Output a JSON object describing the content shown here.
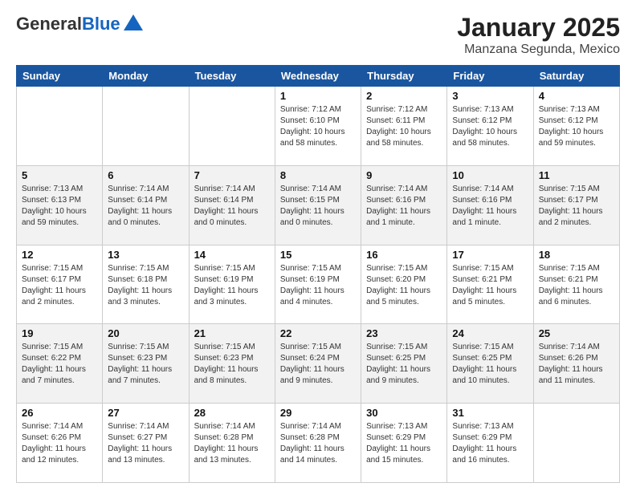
{
  "header": {
    "logo_general": "General",
    "logo_blue": "Blue",
    "title": "January 2025",
    "subtitle": "Manzana Segunda, Mexico"
  },
  "weekdays": [
    "Sunday",
    "Monday",
    "Tuesday",
    "Wednesday",
    "Thursday",
    "Friday",
    "Saturday"
  ],
  "weeks": [
    [
      {
        "day": "",
        "info": ""
      },
      {
        "day": "",
        "info": ""
      },
      {
        "day": "",
        "info": ""
      },
      {
        "day": "1",
        "info": "Sunrise: 7:12 AM\nSunset: 6:10 PM\nDaylight: 10 hours\nand 58 minutes."
      },
      {
        "day": "2",
        "info": "Sunrise: 7:12 AM\nSunset: 6:11 PM\nDaylight: 10 hours\nand 58 minutes."
      },
      {
        "day": "3",
        "info": "Sunrise: 7:13 AM\nSunset: 6:12 PM\nDaylight: 10 hours\nand 58 minutes."
      },
      {
        "day": "4",
        "info": "Sunrise: 7:13 AM\nSunset: 6:12 PM\nDaylight: 10 hours\nand 59 minutes."
      }
    ],
    [
      {
        "day": "5",
        "info": "Sunrise: 7:13 AM\nSunset: 6:13 PM\nDaylight: 10 hours\nand 59 minutes."
      },
      {
        "day": "6",
        "info": "Sunrise: 7:14 AM\nSunset: 6:14 PM\nDaylight: 11 hours\nand 0 minutes."
      },
      {
        "day": "7",
        "info": "Sunrise: 7:14 AM\nSunset: 6:14 PM\nDaylight: 11 hours\nand 0 minutes."
      },
      {
        "day": "8",
        "info": "Sunrise: 7:14 AM\nSunset: 6:15 PM\nDaylight: 11 hours\nand 0 minutes."
      },
      {
        "day": "9",
        "info": "Sunrise: 7:14 AM\nSunset: 6:16 PM\nDaylight: 11 hours\nand 1 minute."
      },
      {
        "day": "10",
        "info": "Sunrise: 7:14 AM\nSunset: 6:16 PM\nDaylight: 11 hours\nand 1 minute."
      },
      {
        "day": "11",
        "info": "Sunrise: 7:15 AM\nSunset: 6:17 PM\nDaylight: 11 hours\nand 2 minutes."
      }
    ],
    [
      {
        "day": "12",
        "info": "Sunrise: 7:15 AM\nSunset: 6:17 PM\nDaylight: 11 hours\nand 2 minutes."
      },
      {
        "day": "13",
        "info": "Sunrise: 7:15 AM\nSunset: 6:18 PM\nDaylight: 11 hours\nand 3 minutes."
      },
      {
        "day": "14",
        "info": "Sunrise: 7:15 AM\nSunset: 6:19 PM\nDaylight: 11 hours\nand 3 minutes."
      },
      {
        "day": "15",
        "info": "Sunrise: 7:15 AM\nSunset: 6:19 PM\nDaylight: 11 hours\nand 4 minutes."
      },
      {
        "day": "16",
        "info": "Sunrise: 7:15 AM\nSunset: 6:20 PM\nDaylight: 11 hours\nand 5 minutes."
      },
      {
        "day": "17",
        "info": "Sunrise: 7:15 AM\nSunset: 6:21 PM\nDaylight: 11 hours\nand 5 minutes."
      },
      {
        "day": "18",
        "info": "Sunrise: 7:15 AM\nSunset: 6:21 PM\nDaylight: 11 hours\nand 6 minutes."
      }
    ],
    [
      {
        "day": "19",
        "info": "Sunrise: 7:15 AM\nSunset: 6:22 PM\nDaylight: 11 hours\nand 7 minutes."
      },
      {
        "day": "20",
        "info": "Sunrise: 7:15 AM\nSunset: 6:23 PM\nDaylight: 11 hours\nand 7 minutes."
      },
      {
        "day": "21",
        "info": "Sunrise: 7:15 AM\nSunset: 6:23 PM\nDaylight: 11 hours\nand 8 minutes."
      },
      {
        "day": "22",
        "info": "Sunrise: 7:15 AM\nSunset: 6:24 PM\nDaylight: 11 hours\nand 9 minutes."
      },
      {
        "day": "23",
        "info": "Sunrise: 7:15 AM\nSunset: 6:25 PM\nDaylight: 11 hours\nand 9 minutes."
      },
      {
        "day": "24",
        "info": "Sunrise: 7:15 AM\nSunset: 6:25 PM\nDaylight: 11 hours\nand 10 minutes."
      },
      {
        "day": "25",
        "info": "Sunrise: 7:14 AM\nSunset: 6:26 PM\nDaylight: 11 hours\nand 11 minutes."
      }
    ],
    [
      {
        "day": "26",
        "info": "Sunrise: 7:14 AM\nSunset: 6:26 PM\nDaylight: 11 hours\nand 12 minutes."
      },
      {
        "day": "27",
        "info": "Sunrise: 7:14 AM\nSunset: 6:27 PM\nDaylight: 11 hours\nand 13 minutes."
      },
      {
        "day": "28",
        "info": "Sunrise: 7:14 AM\nSunset: 6:28 PM\nDaylight: 11 hours\nand 13 minutes."
      },
      {
        "day": "29",
        "info": "Sunrise: 7:14 AM\nSunset: 6:28 PM\nDaylight: 11 hours\nand 14 minutes."
      },
      {
        "day": "30",
        "info": "Sunrise: 7:13 AM\nSunset: 6:29 PM\nDaylight: 11 hours\nand 15 minutes."
      },
      {
        "day": "31",
        "info": "Sunrise: 7:13 AM\nSunset: 6:29 PM\nDaylight: 11 hours\nand 16 minutes."
      },
      {
        "day": "",
        "info": ""
      }
    ]
  ]
}
